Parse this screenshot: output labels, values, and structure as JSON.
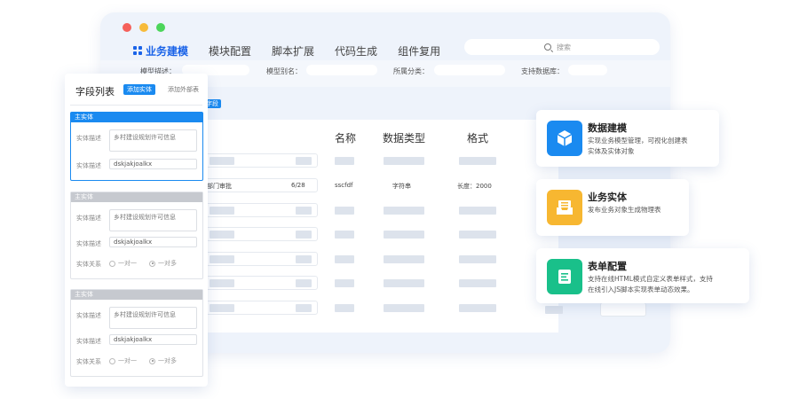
{
  "window": {
    "tabs": [
      "业务建模",
      "模块配置",
      "脚本扩展",
      "代码生成",
      "组件复用"
    ],
    "search_placeholder": "搜索",
    "filters": [
      "模型描述：",
      "模型别名：",
      "所属分类：",
      "支持数据库："
    ],
    "field_tag": "字段",
    "table_headers": [
      "名称",
      "数据类型",
      "格式"
    ],
    "row": {
      "name": "部门审批",
      "count": "6/28",
      "code": "sscfdf",
      "type": "字符串",
      "format": "长度：2000"
    }
  },
  "panel": {
    "title": "字段列表",
    "add_entity": "添加实体",
    "add_external": "添加外部表",
    "entities": [
      {
        "head": "主实体",
        "desc_label": "实体描述",
        "desc_value": "乡村建设规划许可信息",
        "desc_label2": "实体描述",
        "input_value": "dskjakjoalkx"
      },
      {
        "head": "主实体",
        "desc_label": "实体描述",
        "desc_value": "乡村建设规划许可信息",
        "desc_label2": "实体描述",
        "input_value": "dskjakjoalkx",
        "rel_label": "实体关系",
        "opt1": "一对一",
        "opt2": "一对多"
      },
      {
        "head": "主实体",
        "desc_label": "实体描述",
        "desc_value": "乡村建设规划许可信息",
        "desc_label2": "实体描述",
        "input_value": "dskjakjoalkx",
        "rel_label": "实体关系",
        "opt1": "一对一",
        "opt2": "一对多"
      }
    ]
  },
  "features": [
    {
      "title": "数据建模",
      "desc1": "实现业务模型管理，可视化创建表",
      "desc2": "实体及实体对象",
      "color": "#1a8af0",
      "icon": "cube-icon"
    },
    {
      "title": "业务实体",
      "desc1": "发布业务对象生成物理表",
      "desc2": "",
      "color": "#f7b731",
      "icon": "inbox-icon"
    },
    {
      "title": "表单配置",
      "desc1": "支持在线HTML模式自定义表单样式，支持",
      "desc2": "在线引入JS脚本实现表单动态效果。",
      "color": "#19c08a",
      "icon": "document-icon"
    }
  ]
}
